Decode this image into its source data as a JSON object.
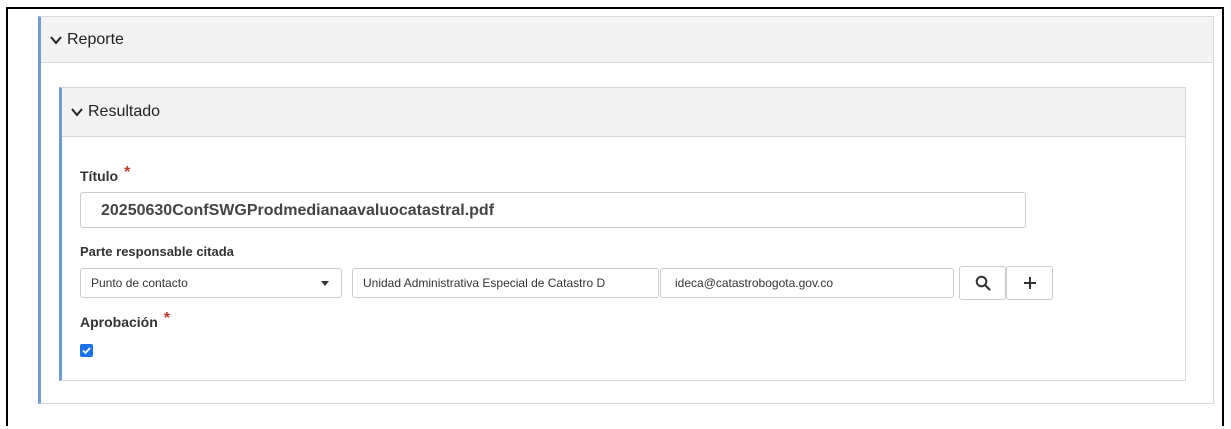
{
  "reporte": {
    "title": "Reporte"
  },
  "resultado": {
    "title": "Resultado",
    "titulo_label": "Título",
    "titulo_value": "20250630ConfSWGProdmedianaavaluocatastral.pdf",
    "parte_label": "Parte responsable citada",
    "role_selected": "Punto de contacto",
    "organization": "Unidad Administrativa Especial de Catastro D",
    "email": "ideca@catastrobogota.gov.co",
    "aprobacion_label": "Aprobación",
    "aprobacion_checked": true,
    "required_mark": "*"
  },
  "colors": {
    "accent": "#6f9bd0",
    "required": "#c0392b",
    "checkbox": "#1a73e8"
  }
}
